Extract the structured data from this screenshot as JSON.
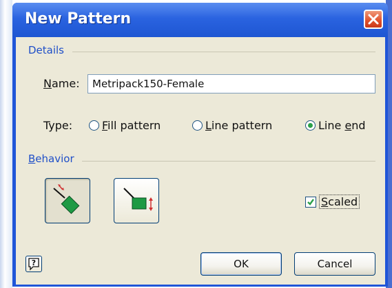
{
  "window": {
    "title": "New Pattern"
  },
  "details": {
    "group_label": "Details",
    "name_label_accel": "N",
    "name_label_rest": "ame:",
    "name_value": "Metripack150-Female",
    "type_label": "Type:",
    "types": [
      {
        "accel": "F",
        "rest": "ill pattern",
        "selected": false
      },
      {
        "accel": "L",
        "rest": "ine pattern",
        "selected": false
      },
      {
        "pre": "Line ",
        "accel": "e",
        "rest": "nd",
        "selected": true
      }
    ]
  },
  "behavior": {
    "group_label_accel": "B",
    "group_label_rest": "ehavior",
    "buttons": [
      {
        "icon": "oriented-end-icon",
        "pressed": true
      },
      {
        "icon": "upright-end-icon",
        "pressed": false
      }
    ],
    "scaled_accel": "S",
    "scaled_rest": "caled",
    "scaled_checked": true
  },
  "footer": {
    "help_icon": "help-icon",
    "ok_label": "OK",
    "cancel_label": "Cancel"
  },
  "colors": {
    "title_blue": "#1f55d8",
    "group_text": "#1f4fc8",
    "shape_green": "#1e9a44",
    "check_green": "#2ba04a"
  }
}
